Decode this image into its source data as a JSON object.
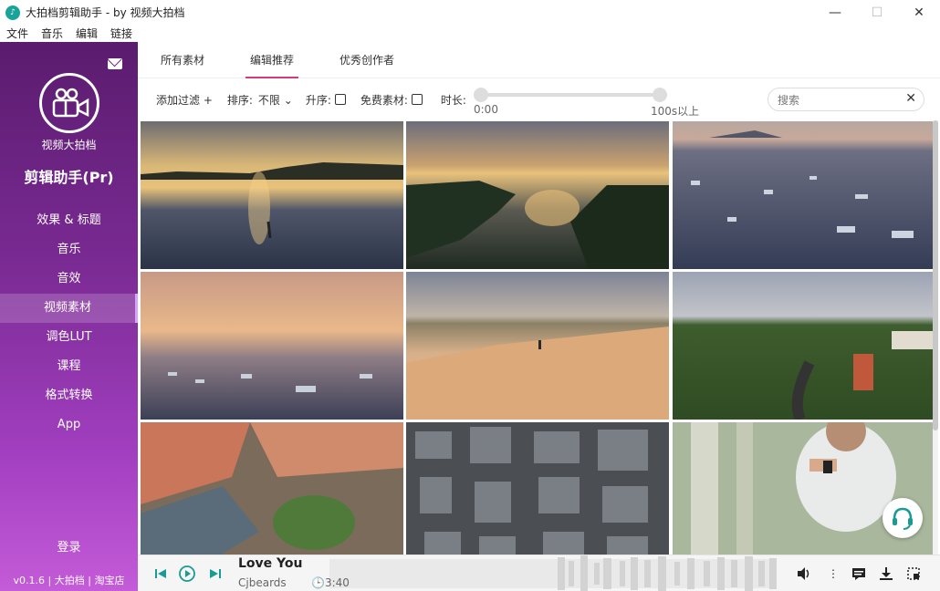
{
  "window": {
    "title": "大拍档剪辑助手 - by 视频大拍档",
    "minimize": "—",
    "maximize": "☐",
    "close": "✕"
  },
  "menu": [
    "文件",
    "音乐",
    "编辑",
    "链接"
  ],
  "sidebar": {
    "brand": "视频大拍档",
    "product": "剪辑助手(Pr)",
    "items": [
      {
        "label": "效果 & 标题",
        "active": false
      },
      {
        "label": "音乐",
        "active": false
      },
      {
        "label": "音效",
        "active": false
      },
      {
        "label": "视频素材",
        "active": true
      },
      {
        "label": "调色LUT",
        "active": false
      },
      {
        "label": "课程",
        "active": false
      },
      {
        "label": "格式转换",
        "active": false
      },
      {
        "label": "App",
        "active": false
      }
    ],
    "login": "登录",
    "footer": {
      "version": "v0.1.6",
      "sep": "|",
      "link1": "大拍档",
      "link2": "淘宝店"
    }
  },
  "tabs": [
    {
      "label": "所有素材",
      "active": false
    },
    {
      "label": "编辑推荐",
      "active": true
    },
    {
      "label": "优秀创作者",
      "active": false
    }
  ],
  "filters": {
    "add_filter": "添加过滤 +",
    "sort_label": "排序:",
    "sort_value": "不限",
    "asc_label": "升序:",
    "free_label": "免费素材:",
    "duration_label": "时长:",
    "duration_min": "0:00",
    "duration_max": "100s以上",
    "search_placeholder": "搜索"
  },
  "thumbnails": [
    "sunset-lake-paddleboard",
    "aerial-river-sunset",
    "boats-in-bay",
    "boats-cloudy-sunset",
    "desert-dune-walker",
    "aerial-train-countryside",
    "aerial-red-roof-buildings",
    "aerial-city-top-down",
    "man-smartwatch"
  ],
  "player": {
    "title": "Love You",
    "artist": "Cjbeards",
    "duration": "3:40"
  },
  "colors": {
    "accent": "#1a9a94",
    "tab_underline": "#d63a7a",
    "sidebar_top": "#5a1c6e",
    "sidebar_bottom": "#c45bd8"
  }
}
